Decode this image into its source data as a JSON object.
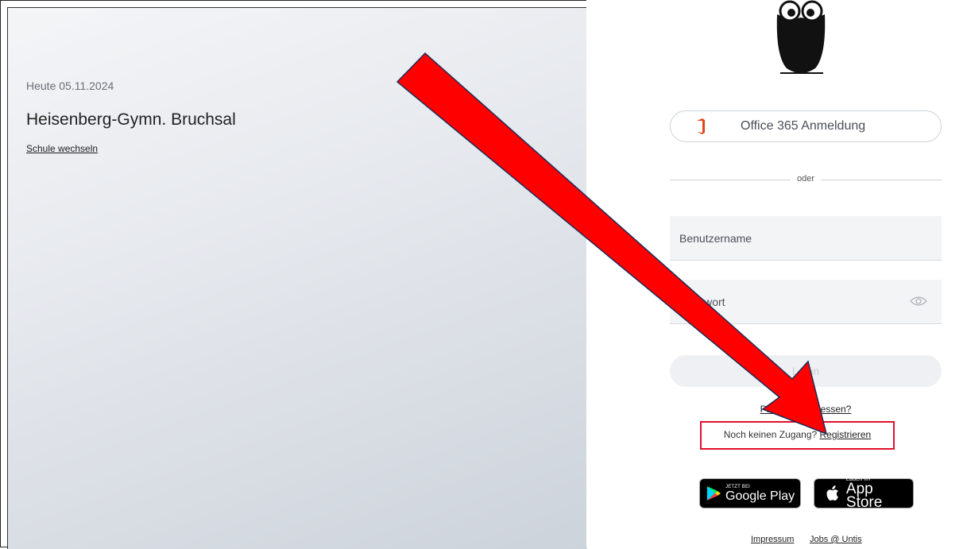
{
  "left": {
    "date": "Heute 05.11.2024",
    "school": "Heisenberg-Gymn. Bruchsal",
    "switch_link": "Schule wechseln"
  },
  "login": {
    "office_button": "Office 365 Anmeldung",
    "divider": "oder",
    "username_placeholder": "Benutzername",
    "password_placeholder": "Passwort",
    "login_button": "Login",
    "forgot_link": "Passwort vergessen?",
    "register_prefix": "Noch keinen Zugang? ",
    "register_link": "Registrieren"
  },
  "stores": {
    "google_small": "JETZT BEI",
    "google_big": "Google Play",
    "apple_small": "Laden im",
    "apple_big": "App Store"
  },
  "footer": {
    "impressum": "Impressum",
    "jobs": "Jobs @ Untis"
  },
  "annotation": {
    "arrow_color": "#ff0000",
    "highlight_color": "#e0102a"
  },
  "icons": [
    "owl-logo",
    "office-icon",
    "eye-icon",
    "google-play-icon",
    "apple-icon"
  ]
}
